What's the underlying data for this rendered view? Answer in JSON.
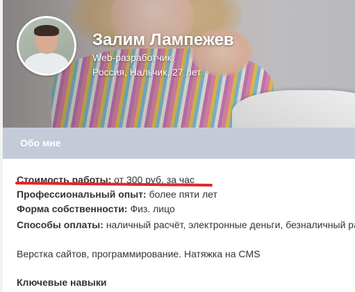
{
  "profile": {
    "name": "Залим Лампежев",
    "role": "Web-разработчик",
    "location": "Россия, Нальчик, 27 лет"
  },
  "about": {
    "title": "Обо мне",
    "rows": [
      {
        "label": "Стоимость работы:",
        "value": "от 300 руб. за час"
      },
      {
        "label": "Профессиональный опыт:",
        "value": "более пяти лет"
      },
      {
        "label": "Форма собственности:",
        "value": "Физ. лицо"
      },
      {
        "label": "Способы оплаты:",
        "value": "наличный расчёт, электронные деньги, безналичный рас"
      }
    ],
    "description": "Верстка сайтов, программирование. Натяжка на CMS",
    "skills_heading": "Ключевые навыки"
  },
  "colors": {
    "section_bar": "#c5cad8",
    "highlight_underline": "#e0252c"
  }
}
